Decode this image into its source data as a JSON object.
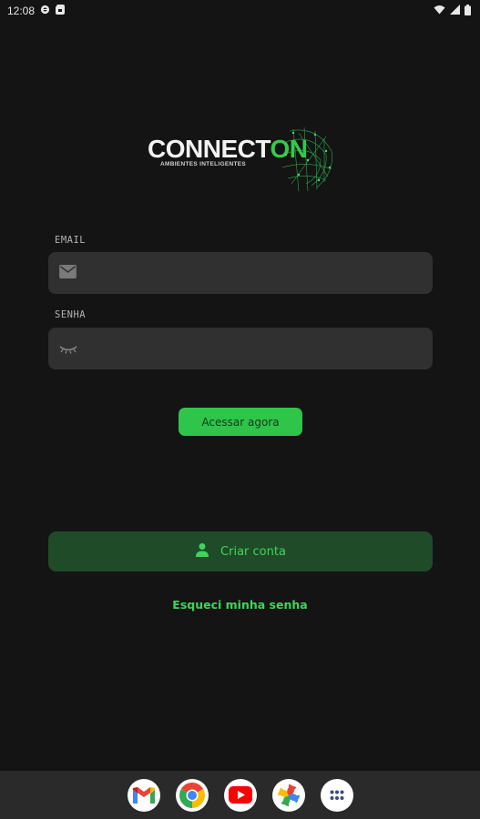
{
  "status_bar": {
    "time": "12:08"
  },
  "logo": {
    "title_main": "CONNECT",
    "title_accent": "ON",
    "subtitle": "AMBIENTES INTELIGENTES"
  },
  "form": {
    "email_label": "EMAIL",
    "email_value": "",
    "password_label": "SENHA",
    "password_value": ""
  },
  "buttons": {
    "login": "Acessar agora",
    "create_account": "Criar conta",
    "forgot_password": "Esqueci minha senha"
  },
  "dock": {
    "apps": [
      "gmail-icon",
      "chrome-icon",
      "youtube-icon",
      "photos-icon",
      "app-drawer-icon"
    ]
  },
  "colors": {
    "background": "#141414",
    "accent_green": "#2fc44a",
    "create_button_bg": "#1f4b29",
    "field_bg": "#303030"
  }
}
